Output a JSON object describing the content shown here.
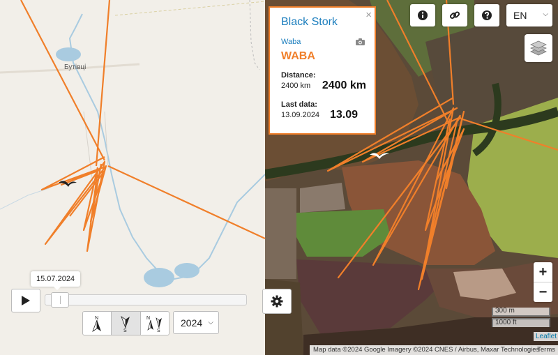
{
  "map": {
    "village_label": "Бутівці",
    "colors": {
      "track": "#f07f2a",
      "river": "#a9cbe0",
      "popup_border": "#f07f2a"
    }
  },
  "popup": {
    "close_label": "×",
    "title": "Black Stork",
    "subtitle": "Waba",
    "code": "WABA",
    "distance_label": "Distance:",
    "distance_small": "2400 km",
    "distance_big": "2400 km",
    "lastdata_label": "Last data:",
    "lastdata_small": "13.09.2024",
    "lastdata_big": "13.09"
  },
  "toolbar": {
    "language": "EN",
    "icons": [
      "info-icon",
      "link-icon",
      "help-icon",
      "layers-icon"
    ]
  },
  "zoom": {
    "in_label": "+",
    "out_label": "−"
  },
  "scale": {
    "metric": "300 m",
    "imperial": "1000 ft"
  },
  "attribution": {
    "leaflet": "Leaflet",
    "text": "Map data ©2024 Google Imagery ©2024 CNES / Airbus, Maxar Technologies",
    "terms": "Terms"
  },
  "timeline": {
    "current_date": "15.07.2024",
    "progress": 0.03,
    "year": "2024",
    "direction_modes": [
      "north-up",
      "south-up",
      "north-south"
    ]
  }
}
